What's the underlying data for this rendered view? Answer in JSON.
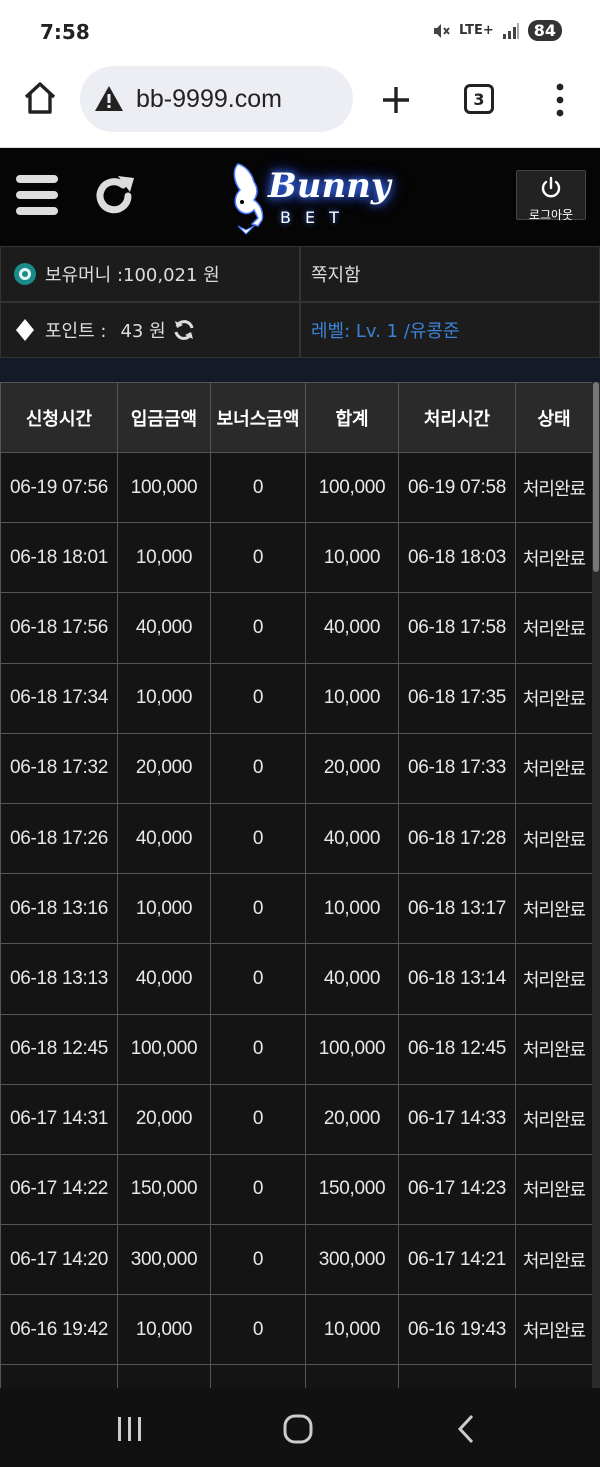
{
  "status": {
    "time": "7:58",
    "network": "LTE+",
    "battery": "84"
  },
  "browser": {
    "url": "bb-9999.com",
    "tab_count": "3"
  },
  "header": {
    "logo_text": "Bunny",
    "logo_sub": "BET",
    "logout_label": "로그아웃"
  },
  "info": {
    "money_label": "보유머니 :100,021 원",
    "points_label": "포인트 :",
    "points_value": "43 원",
    "messages_label": "쪽지함",
    "level_label": "레벨: Lv. 1 /유콩준"
  },
  "table": {
    "headers": [
      "신청시간",
      "입금금액",
      "보너스금액",
      "합계",
      "처리시간",
      "상태"
    ],
    "rows": [
      [
        "06-19 07:56",
        "100,000",
        "0",
        "100,000",
        "06-19 07:58",
        "처리완료"
      ],
      [
        "06-18 18:01",
        "10,000",
        "0",
        "10,000",
        "06-18 18:03",
        "처리완료"
      ],
      [
        "06-18 17:56",
        "40,000",
        "0",
        "40,000",
        "06-18 17:58",
        "처리완료"
      ],
      [
        "06-18 17:34",
        "10,000",
        "0",
        "10,000",
        "06-18 17:35",
        "처리완료"
      ],
      [
        "06-18 17:32",
        "20,000",
        "0",
        "20,000",
        "06-18 17:33",
        "처리완료"
      ],
      [
        "06-18 17:26",
        "40,000",
        "0",
        "40,000",
        "06-18 17:28",
        "처리완료"
      ],
      [
        "06-18 13:16",
        "10,000",
        "0",
        "10,000",
        "06-18 13:17",
        "처리완료"
      ],
      [
        "06-18 13:13",
        "40,000",
        "0",
        "40,000",
        "06-18 13:14",
        "처리완료"
      ],
      [
        "06-18 12:45",
        "100,000",
        "0",
        "100,000",
        "06-18 12:45",
        "처리완료"
      ],
      [
        "06-17 14:31",
        "20,000",
        "0",
        "20,000",
        "06-17 14:33",
        "처리완료"
      ],
      [
        "06-17 14:22",
        "150,000",
        "0",
        "150,000",
        "06-17 14:23",
        "처리완료"
      ],
      [
        "06-17 14:20",
        "300,000",
        "0",
        "300,000",
        "06-17 14:21",
        "처리완료"
      ],
      [
        "06-16 19:42",
        "10,000",
        "0",
        "10,000",
        "06-16 19:43",
        "처리완료"
      ],
      [
        "",
        "",
        "",
        "",
        "",
        ""
      ]
    ]
  },
  "icons": {
    "home": "home-icon",
    "warning": "warning-icon",
    "plus": "plus-icon",
    "menu": "hamburger-icon",
    "reload": "reload-icon",
    "power": "power-icon",
    "coin": "coin-icon",
    "diamond": "diamond-icon",
    "refresh": "refresh-icon"
  },
  "colors": {
    "accent_blue": "#3b83d8",
    "background": "#000000",
    "header_bg": "#2a2a2a"
  }
}
